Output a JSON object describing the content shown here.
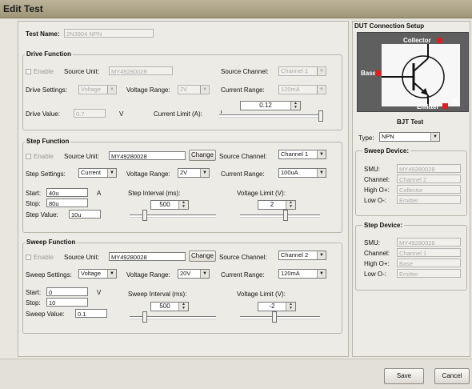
{
  "window": {
    "title": "Edit Test"
  },
  "test_name": {
    "label": "Test Name:",
    "value": "2N3904 NPN"
  },
  "drive": {
    "title": "Drive Function",
    "enable_label": "Enable",
    "source_unit_label": "Source Unit:",
    "source_unit_value": "MY49280028",
    "source_channel_label": "Source Channel:",
    "source_channel_value": "Channel 1",
    "settings_label": "Drive Settings:",
    "settings_value": "Voltage",
    "voltage_range_label": "Voltage Range:",
    "voltage_range_value": "2V",
    "current_range_label": "Current Range:",
    "current_range_value": "120mA",
    "value_label": "Drive Value:",
    "value_value": "0.7",
    "value_unit": "V",
    "current_limit_label": "Current Limit (A):",
    "current_limit_value": "0.12"
  },
  "step": {
    "title": "Step Function",
    "enable_label": "Enable",
    "source_unit_label": "Source Unit:",
    "source_unit_value": "MY49280028",
    "change_label": "Change",
    "source_channel_label": "Source Channel:",
    "source_channel_value": "Channel 1",
    "settings_label": "Step Settings:",
    "settings_value": "Current",
    "voltage_range_label": "Voltage Range:",
    "voltage_range_value": "2V",
    "current_range_label": "Current Range:",
    "current_range_value": "100uA",
    "start_label": "Start:",
    "start_value": "40u",
    "start_unit": "A",
    "stop_label": "Stop:",
    "stop_value": "80u",
    "stepval_label": "Step Value:",
    "stepval_value": "10u",
    "interval_label": "Step Interval (ms):",
    "interval_value": "500",
    "vlimit_label": "Voltage Limit (V):",
    "vlimit_value": "2"
  },
  "sweep": {
    "title": "Sweep Function",
    "enable_label": "Enable",
    "source_unit_label": "Source Unit:",
    "source_unit_value": "MY49280028",
    "change_label": "Change",
    "source_channel_label": "Source Channel:",
    "source_channel_value": "Channel 2",
    "settings_label": "Sweep Settings:",
    "settings_value": "Voltage",
    "voltage_range_label": "Voltage Range:",
    "voltage_range_value": "20V",
    "current_range_label": "Current Range:",
    "current_range_value": "120mA",
    "start_label": "Start:",
    "start_value": "0",
    "start_unit": "V",
    "stop_label": "Stop:",
    "stop_value": "10",
    "sweepval_label": "Sweep Value:",
    "sweepval_value": "0.1",
    "interval_label": "Sweep Interval (ms):",
    "interval_value": "500",
    "vlimit_label": "Voltage Limit (V):",
    "vlimit_value": "-2"
  },
  "dut": {
    "title": "DUT Connection Setup",
    "collector_label": "Collector",
    "base_label": "Base",
    "emitter_label": "Emitter",
    "bjt_title": "BJT Test",
    "type_label": "Type:",
    "type_value": "NPN"
  },
  "sweep_device": {
    "title": "Sweep Device:",
    "smu_label": "SMU:",
    "smu_value": "MY49280028",
    "channel_label": "Channel:",
    "channel_value": "Channel 2",
    "high_label": "High O+:",
    "high_value": "Collector",
    "low_label": "Low O-:",
    "low_value": "Emitter"
  },
  "step_device": {
    "title": "Step Device:",
    "smu_label": "SMU:",
    "smu_value": "MY49280028",
    "channel_label": "Channel:",
    "channel_value": "Channel 1",
    "high_label": "High O+:",
    "high_value": "Base",
    "low_label": "Low O-:",
    "low_value": "Emitter"
  },
  "footer": {
    "save_label": "Save",
    "cancel_label": "Cancel"
  },
  "colors": {
    "title_bar": "#a99f82",
    "terminal_marker": "#e02020",
    "diagram_bg": "#5f5f5f"
  },
  "icons": [
    "checkbox-icon",
    "dropdown-arrow-icon",
    "spinner-arrows-icon",
    "transistor-diagram-icon",
    "mouse-cursor-icon"
  ]
}
